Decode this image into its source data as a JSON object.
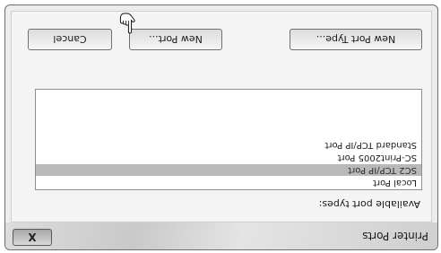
{
  "dialog": {
    "title": "Printer Ports",
    "close_label": "X"
  },
  "ports": {
    "label": "Available port types:",
    "items": [
      {
        "label": "Local Port",
        "selected": false
      },
      {
        "label": "SC2 TCP/IP Port",
        "selected": true
      },
      {
        "label": "SC-Print2005 Port",
        "selected": false
      },
      {
        "label": "Standard TCP/IP Port",
        "selected": false
      }
    ]
  },
  "buttons": {
    "new_port_type": "New Port Type...",
    "new_port": "New Port...",
    "cancel": "Cancel"
  },
  "icons": {
    "close": "close-icon",
    "cursor": "hand-pointer-icon"
  }
}
